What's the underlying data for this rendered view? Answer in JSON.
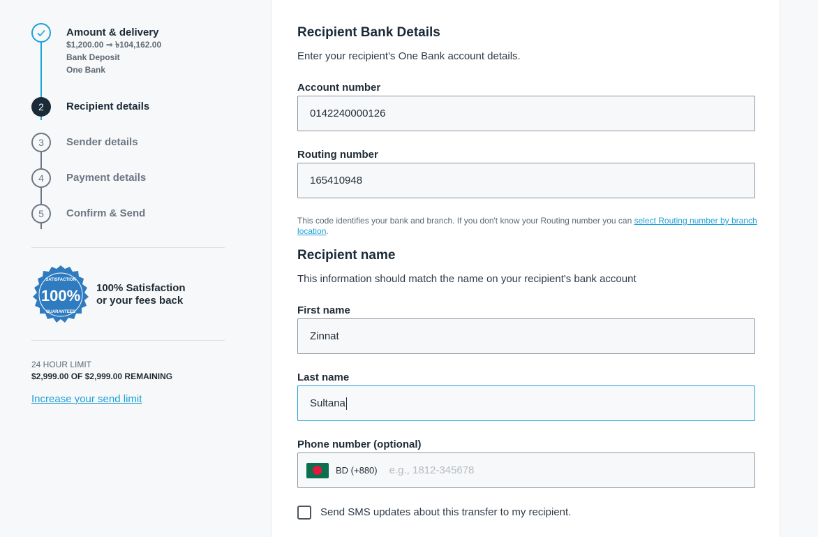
{
  "sidebar": {
    "steps": [
      {
        "number": "",
        "title": "Amount & delivery",
        "sub": [
          "$1,200.00 ⇒ ৳104,162.00",
          "Bank Deposit",
          "One Bank"
        ],
        "state": "done"
      },
      {
        "number": "2",
        "title": "Recipient details",
        "state": "active"
      },
      {
        "number": "3",
        "title": "Sender details",
        "state": "todo"
      },
      {
        "number": "4",
        "title": "Payment details",
        "state": "todo"
      },
      {
        "number": "5",
        "title": "Confirm & Send",
        "state": "todo"
      }
    ],
    "badge": {
      "line1": "100% Satisfaction",
      "line2": "or your fees back",
      "seal_top": "SATISFACTION",
      "seal_center": "100%",
      "seal_bottom": "GUARANTEED"
    },
    "limit": {
      "label": "24 HOUR LIMIT",
      "value": "$2,999.00 OF $2,999.00 REMAINING",
      "link": "Increase your send limit"
    }
  },
  "main": {
    "bank_heading": "Recipient Bank Details",
    "bank_desc": "Enter your recipient's One Bank account details.",
    "account_label": "Account number",
    "account_value": "0142240000126",
    "routing_label": "Routing number",
    "routing_value": "165410948",
    "hint_text": "This code identifies your bank and branch. If you don't know your Routing number you can ",
    "hint_link": "select Routing number by branch location",
    "hint_end": ".",
    "name_heading": "Recipient name",
    "name_desc": "This information should match the name on your recipient's bank account",
    "first_label": "First name",
    "first_value": "Zinnat",
    "last_label": "Last name",
    "last_value": "Sultana",
    "phone_label": "Phone number (optional)",
    "phone_country": "BD (+880)",
    "phone_placeholder": "e.g., 1812-345678",
    "sms_label": "Send SMS updates about this transfer to my recipient."
  },
  "colors": {
    "accent": "#1ea0d8",
    "dark": "#1b2a37",
    "badge": "#2f7bbf"
  }
}
